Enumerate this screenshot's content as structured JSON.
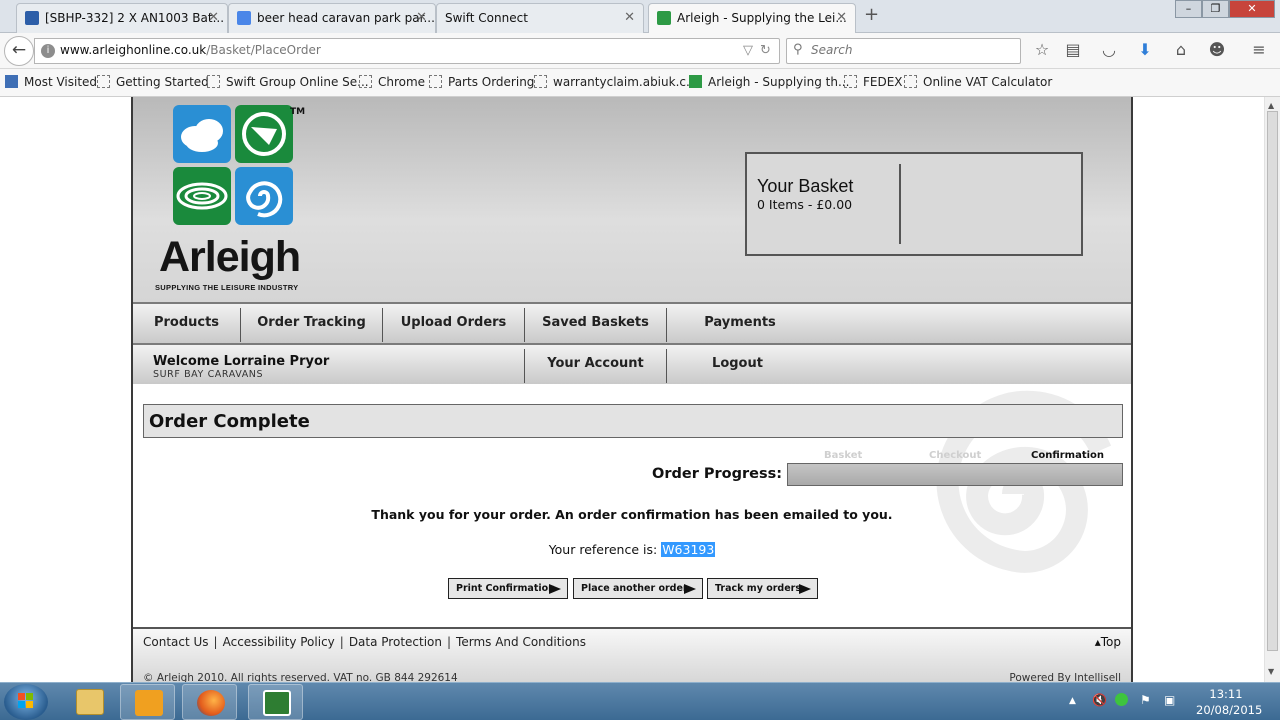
{
  "browser": {
    "tabs": [
      {
        "title": "[SBHP-332] 2 X AN1003 Bat...",
        "active": false
      },
      {
        "title": "beer head caravan park par...",
        "active": false
      },
      {
        "title": "Swift Connect",
        "active": false
      },
      {
        "title": "Arleigh - Supplying the Lei...",
        "active": true
      }
    ],
    "new_tab_label": "+",
    "window_controls": {
      "minimize": "–",
      "restore": "❐",
      "close": "✕"
    },
    "url_host": "www.arleighonline.co.uk",
    "url_path": "/Basket/PlaceOrder",
    "search_placeholder": "Search",
    "bookmarks": [
      "Most Visited",
      "Getting Started",
      "Swift Group Online Se...",
      "Chrome",
      "Parts Ordering",
      "warrantyclaim.abiuk.c...",
      "Arleigh - Supplying th...",
      "FEDEX",
      "Online VAT Calculator"
    ]
  },
  "site": {
    "logo_tm": "TM",
    "logo_text": "Arleigh",
    "logo_tagline": "SUPPLYING THE LEISURE INDUSTRY",
    "basket": {
      "title": "Your Basket",
      "summary": "0 Items - £0.00"
    },
    "nav": [
      "Products",
      "Order Tracking",
      "Upload Orders",
      "Saved Baskets",
      "Payments"
    ],
    "user": {
      "welcome": "Welcome Lorraine Pryor",
      "company": "SURF BAY CARAVANS"
    },
    "account_links": [
      "Your Account",
      "Logout"
    ],
    "order": {
      "heading": "Order Complete",
      "progress_label": "Order Progress:",
      "steps": [
        "Basket",
        "Checkout",
        "Confirmation"
      ],
      "current_step": "Confirmation",
      "progress_fraction": 1.0,
      "thanks": "Thank you for your order. An order confirmation has been emailed to you.",
      "reference_label": "Your reference is:",
      "reference_value": "W63193",
      "buttons": [
        "Print Confirmation",
        "Place another order",
        "Track my orders"
      ]
    },
    "footer": {
      "links": [
        "Contact Us",
        "Accessibility Policy",
        "Data Protection",
        "Terms And Conditions"
      ],
      "separator": "|",
      "top_link": "▴Top",
      "copyright": "© Arleigh 2010. All rights reserved. VAT no. GB 844 292614",
      "powered_by": "Powered By Intellisell"
    }
  },
  "taskbar": {
    "time": "13:11",
    "date": "20/08/2015"
  },
  "colors": {
    "logo_blue": "#2a8fd4",
    "logo_green": "#1a8a3c",
    "selection": "#3399ff"
  }
}
